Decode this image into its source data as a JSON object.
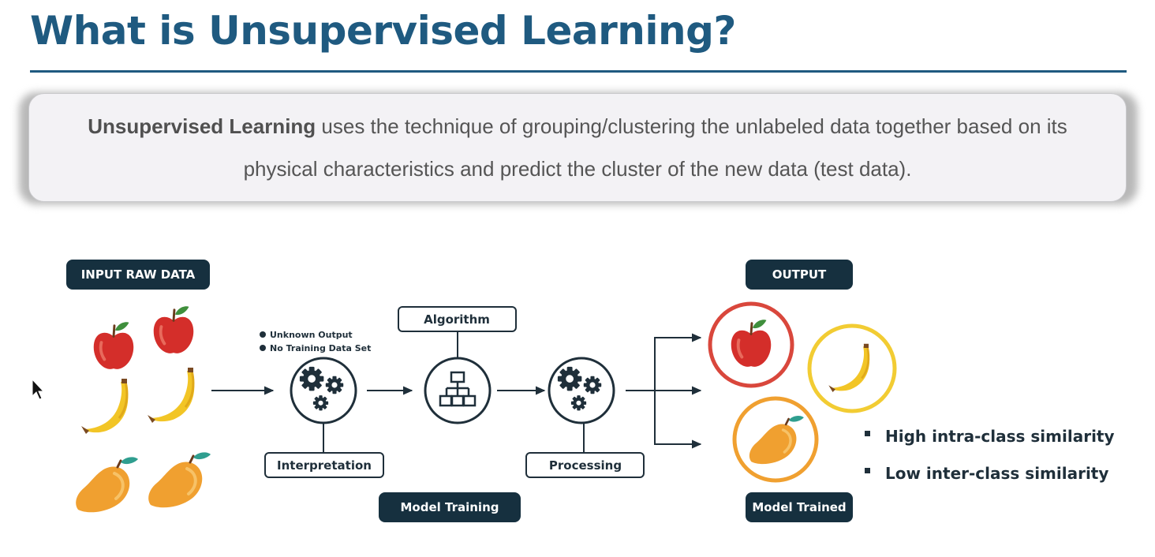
{
  "slide": {
    "title": "What is Unsupervised Learning?",
    "definition": {
      "term": "Unsupervised Learning",
      "text": " uses the technique of grouping/clustering the unlabeled data together based on its physical characteristics and predict the cluster of the new data (test data)."
    }
  },
  "diagram": {
    "input_label": "INPUT RAW DATA",
    "output_label": "OUTPUT",
    "notes": [
      "Unknown Output",
      "No Training Data Set"
    ],
    "algorithm_label": "Algorithm",
    "interpretation_label": "Interpretation",
    "processing_label": "Processing",
    "model_training_label": "Model Training",
    "model_trained_label": "Model Trained",
    "similarity": [
      "High intra-class similarity",
      "Low inter-class similarity"
    ]
  },
  "colors": {
    "title": "#1f5a80",
    "pill": "#16303f",
    "apple": "#d42e2a",
    "banana": "#f2c526",
    "mango": "#f0a030",
    "ring_red": "#d9473c",
    "ring_yellow": "#f2cc33",
    "ring_orange": "#f0a030"
  },
  "icons": [
    "apple-icon",
    "banana-icon",
    "mango-icon",
    "gears-icon",
    "hierarchy-icon",
    "arrow-icon",
    "cursor-icon"
  ]
}
